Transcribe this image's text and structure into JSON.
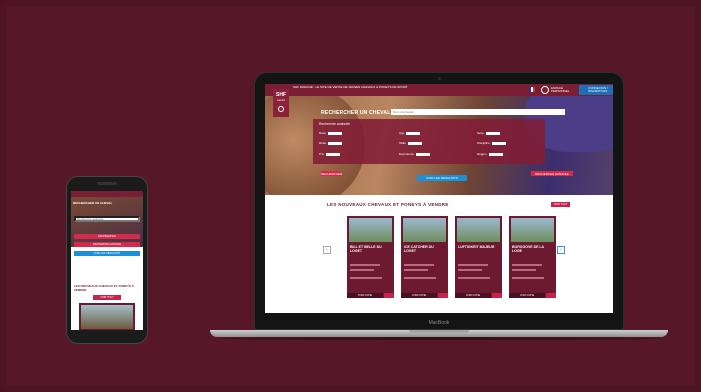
{
  "site": {
    "header_title": "SHF MARCHÉ · LE SITE DE VENTE DE JEUNES CHEVAUX & PONEYS DE SPORT",
    "logo_text": "SHF",
    "logo_sub": "marché",
    "account_label": "ESPACE PERSONNEL",
    "cart_label": "CONNEXION / INSCRIPTION",
    "accent": "#7a1e34",
    "blue": "#1c8fd9",
    "pink": "#d32b4b"
  },
  "hero": {
    "title": "RECHERCHER UN CHEVAL",
    "search_placeholder": "Nom du cheval...",
    "panel_title": "Recherche avancée",
    "filters": [
      {
        "label": "Race",
        "value": "Toutes"
      },
      {
        "label": "Age",
        "value": "Tous"
      },
      {
        "label": "Sexe",
        "value": "Tous"
      },
      {
        "label": "Robe",
        "value": "Toutes"
      },
      {
        "label": "Taille",
        "value": "Toutes"
      },
      {
        "label": "Discipline",
        "value": "Toutes"
      },
      {
        "label": "Prix",
        "value": "Min / Max"
      },
      {
        "label": "Expérience",
        "value": "Toutes"
      },
      {
        "label": "Région",
        "value": "Toutes"
      }
    ],
    "btn_left": "RECHERCHER",
    "btn_center": "VOIR LES RESULTATS",
    "btn_right": "RECHERCHE AVANCEE"
  },
  "section": {
    "title": "LES NOUVEAUX CHEVAUX ET PONEYS À VENDRE",
    "see_all": "VOIR TOUT",
    "cta": "VOIR FICHE",
    "cards": [
      {
        "name": "BILL ET BELLE DU LOGET"
      },
      {
        "name": "ICE CATCHER DU LOGET"
      },
      {
        "name": "LUFTIGKEIT MAJEUR"
      },
      {
        "name": "BOROGOVE DE LA LOGE"
      }
    ]
  },
  "laptop_brand": "MacBook",
  "phone": {
    "title": "RECHERCHER UN CHEVAL",
    "search_placeholder": "Recherche avancée",
    "btn1": "RECHERCHER",
    "btn2": "RECHERCHE AVANCEE",
    "btn3": "VOIR LES RESULTATS",
    "section_title": "LES NOUVEAUX CHEVAUX ET PONEYS À VENDRE",
    "section_btn": "VOIR TOUT"
  }
}
